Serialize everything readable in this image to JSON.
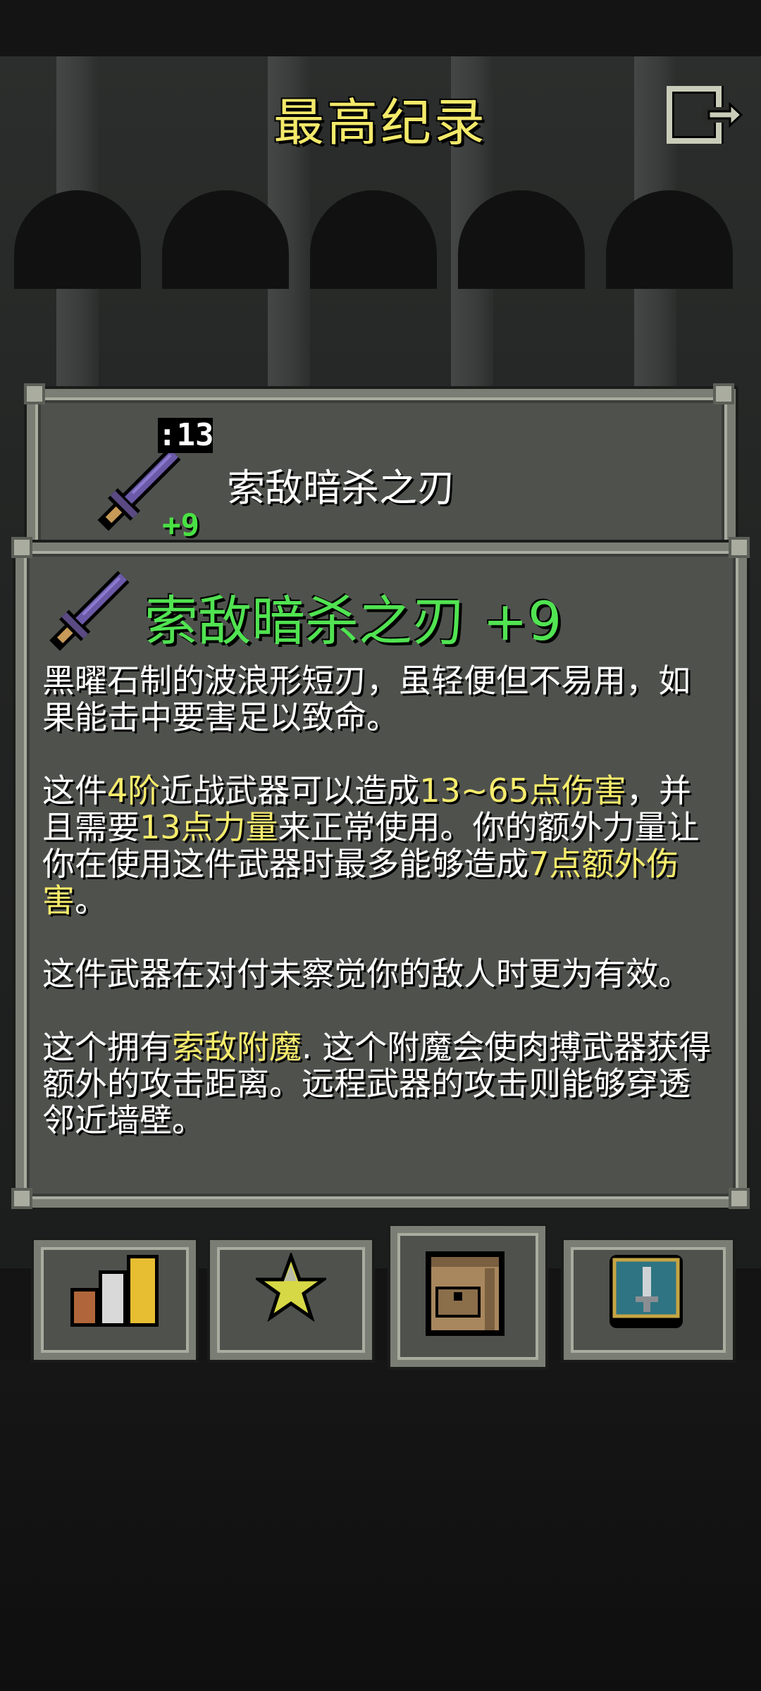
{
  "header": {
    "title": "最高纪录",
    "exit_icon": "exit-icon"
  },
  "item_card": {
    "name": "索敌暗杀之刃",
    "tier_badge": ":13",
    "level_badge": "+9"
  },
  "detail": {
    "title": "索敌暗杀之刃 +9",
    "p1": "黑曜石制的波浪形短刃，虽轻便但不易用，如果能击中要害足以致命。",
    "p2": {
      "t1": "这件",
      "h1": "4阶",
      "t2": "近战武器可以造成",
      "h2": "13~65点伤害",
      "t3": "，并且需要",
      "h3": "13点力量",
      "t4": "来正常使用。你的额外力量让你在使用这件武器时最多能够造成",
      "h4": "7点额外伤害",
      "t5": "。"
    },
    "p3": "这件武器在对付未察觉你的敌人时更为有效。",
    "p4": {
      "t1": "这个拥有",
      "h1": "索敌附魔",
      "t2": ". 这个附魔会使肉搏武器获得额外的攻击距离。远程武器的攻击则能够穿透邻近墙壁。"
    }
  },
  "tabs": [
    {
      "icon": "stats-icon"
    },
    {
      "icon": "badges-star-icon"
    },
    {
      "icon": "inventory-backpack-icon"
    },
    {
      "icon": "talents-sword-icon"
    }
  ],
  "colors": {
    "highlight": "#f6ec6c",
    "item_title": "#51e352",
    "title": "#f3e96a"
  }
}
